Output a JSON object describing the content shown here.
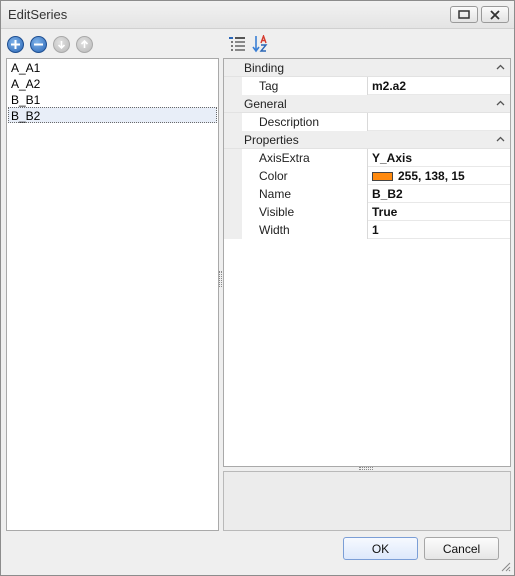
{
  "window": {
    "title": "EditSeries"
  },
  "left_toolbar": {
    "buttons": [
      {
        "icon": "add-icon",
        "enabled": true
      },
      {
        "icon": "remove-icon",
        "enabled": true
      },
      {
        "icon": "move-down-icon",
        "enabled": false
      },
      {
        "icon": "move-up-icon",
        "enabled": false
      }
    ]
  },
  "series_list": {
    "items": [
      "A_A1",
      "A_A2",
      "B_B1",
      "B_B2"
    ],
    "selected": "B_B2"
  },
  "property_grid": {
    "toolbar": [
      "categorized-icon",
      "sort-alphabetical-icon"
    ],
    "categories": {
      "binding": {
        "label": "Binding",
        "tag_name": "Tag",
        "tag_value": "m2.a2"
      },
      "general": {
        "label": "General",
        "description_name": "Description",
        "description_value": ""
      },
      "properties": {
        "label": "Properties",
        "axis_extra_name": "AxisExtra",
        "axis_extra_value": "Y_Axis",
        "color_name": "Color",
        "color_value": "255, 138, 15",
        "color_hex": "#ff8a0f",
        "name_name": "Name",
        "name_value": "B_B2",
        "visible_name": "Visible",
        "visible_value": "True",
        "width_name": "Width",
        "width_value": "1"
      }
    }
  },
  "footer": {
    "ok_label": "OK",
    "cancel_label": "Cancel"
  },
  "colors": {
    "accent": "#2a66b6",
    "ok_border": "#7b9ed6"
  }
}
